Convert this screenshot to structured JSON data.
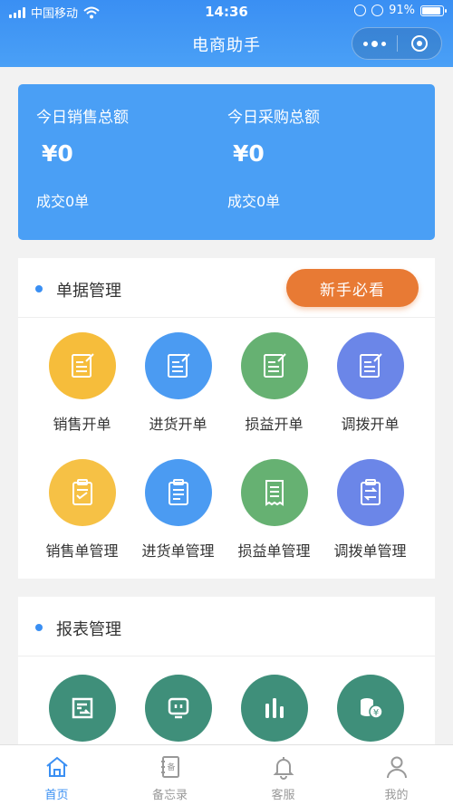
{
  "status_bar": {
    "carrier": "中国移动",
    "time": "14:36",
    "battery": "91%",
    "battery_level": 0.91
  },
  "nav": {
    "title": "电商助手",
    "more_icon": "more-dots-icon",
    "close_icon": "target-circle-icon"
  },
  "summary": {
    "sales_label": "今日销售总额",
    "sales_amount": "¥0",
    "sales_count": "成交0单",
    "purchase_label": "今日采购总额",
    "purchase_amount": "¥0",
    "purchase_count": "成交0单"
  },
  "documents": {
    "title": "单据管理",
    "guide_button": "新手必看",
    "items": [
      {
        "label": "销售开单",
        "color": "#f6bd3b",
        "icon": "edit-note-icon"
      },
      {
        "label": "进货开单",
        "color": "#4b9bf2",
        "icon": "edit-note-icon"
      },
      {
        "label": "损益开单",
        "color": "#66b172",
        "icon": "edit-note-icon"
      },
      {
        "label": "调拨开单",
        "color": "#6b86e8",
        "icon": "edit-note-icon"
      },
      {
        "label": "销售单管理",
        "color": "#f6c145",
        "icon": "clipboard-icon"
      },
      {
        "label": "进货单管理",
        "color": "#4b9bf2",
        "icon": "clipboard-icon"
      },
      {
        "label": "损益单管理",
        "color": "#66b172",
        "icon": "receipt-icon"
      },
      {
        "label": "调拨单管理",
        "color": "#6b86e8",
        "icon": "clipboard-transfer-icon"
      }
    ]
  },
  "reports": {
    "title": "报表管理",
    "items": [
      {
        "color": "#3f8f7a",
        "icon": "report-transfer-icon"
      },
      {
        "color": "#3f8f7a",
        "icon": "monitor-icon"
      },
      {
        "color": "#3f8f7a",
        "icon": "bar-chart-icon"
      },
      {
        "color": "#3f8f7a",
        "icon": "coins-yen-icon"
      }
    ]
  },
  "tabbar": {
    "items": [
      {
        "label": "首页",
        "icon": "home-icon",
        "active": true
      },
      {
        "label": "备忘录",
        "icon": "memo-icon",
        "active": false
      },
      {
        "label": "客服",
        "icon": "bell-icon",
        "active": false
      },
      {
        "label": "我的",
        "icon": "user-icon",
        "active": false
      }
    ]
  },
  "colors": {
    "primary": "#3a8ff3",
    "summary_bg": "#4a9ff5",
    "accent_orange": "#e87a34"
  }
}
